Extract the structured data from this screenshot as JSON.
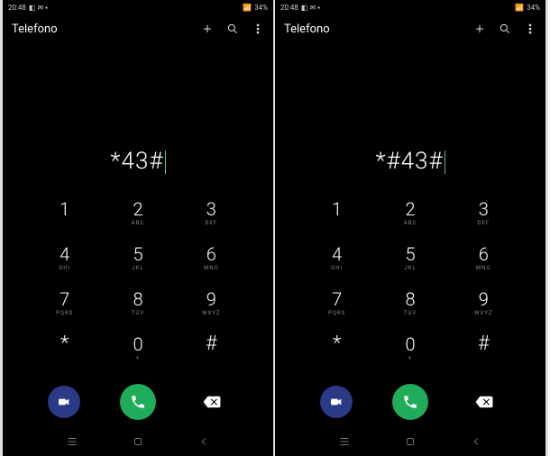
{
  "left": {
    "statusbar": {
      "time": "20:48",
      "battery": "34%"
    },
    "app_title": "Telefono",
    "dialed": "*43#",
    "keys": [
      {
        "d": "1",
        "s": ""
      },
      {
        "d": "2",
        "s": "ABC"
      },
      {
        "d": "3",
        "s": "DEF"
      },
      {
        "d": "4",
        "s": "GHI"
      },
      {
        "d": "5",
        "s": "JKL"
      },
      {
        "d": "6",
        "s": "MNO"
      },
      {
        "d": "7",
        "s": "PQRS"
      },
      {
        "d": "8",
        "s": "TUV"
      },
      {
        "d": "9",
        "s": "WXYZ"
      },
      {
        "d": "*",
        "s": ""
      },
      {
        "d": "0",
        "s": "+"
      },
      {
        "d": "#",
        "s": ""
      }
    ]
  },
  "right": {
    "statusbar": {
      "time": "20:48",
      "battery": "34%"
    },
    "app_title": "Telefono",
    "dialed": "*#43#",
    "keys": [
      {
        "d": "1",
        "s": ""
      },
      {
        "d": "2",
        "s": "ABC"
      },
      {
        "d": "3",
        "s": "DEF"
      },
      {
        "d": "4",
        "s": "GHI"
      },
      {
        "d": "5",
        "s": "JKL"
      },
      {
        "d": "6",
        "s": "MNO"
      },
      {
        "d": "7",
        "s": "PQRS"
      },
      {
        "d": "8",
        "s": "TUV"
      },
      {
        "d": "9",
        "s": "WXYZ"
      },
      {
        "d": "*",
        "s": ""
      },
      {
        "d": "0",
        "s": "+"
      },
      {
        "d": "#",
        "s": ""
      }
    ]
  },
  "colors": {
    "call": "#1fac5b",
    "video": "#2b3a86",
    "cursor": "#4fc08d"
  }
}
